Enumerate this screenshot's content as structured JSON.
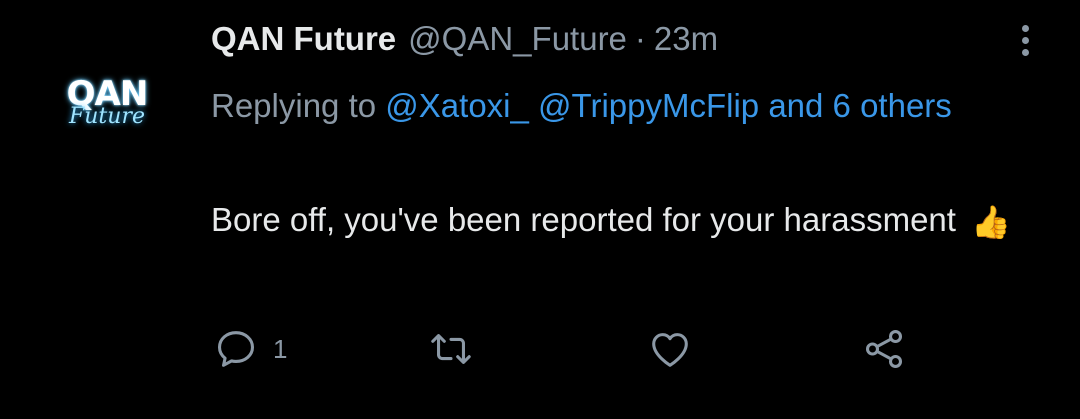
{
  "avatar": {
    "logo_top": "QAN",
    "logo_bottom": "Future"
  },
  "tweet": {
    "display_name": "QAN Future",
    "handle": "@QAN_Future",
    "separator": "·",
    "time": "23m",
    "replying_prefix": "Replying to",
    "mention_1": "@Xatoxi_",
    "mention_2": "@TrippyMcFlip",
    "mention_others": "and 6 others",
    "text": "Bore off, you've been reported for your harassment",
    "emoji": "👍"
  },
  "actions": {
    "reply_count": "1",
    "icons": [
      "comment-icon",
      "retweet-icon",
      "like-icon",
      "share-icon",
      "more-icon"
    ]
  },
  "colors": {
    "background": "#000000",
    "text": "#e7e9ea",
    "secondary": "#8b98a5",
    "link": "#3a97e8"
  }
}
